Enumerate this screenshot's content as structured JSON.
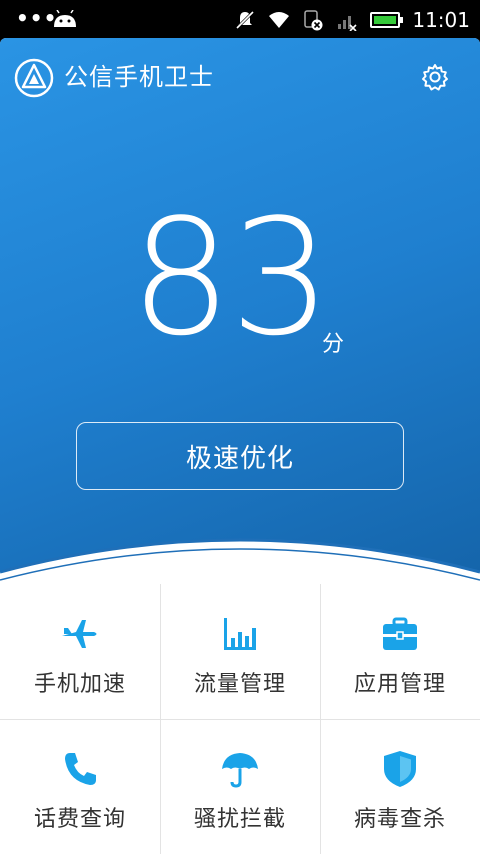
{
  "statusbar": {
    "time": "11:01",
    "icons": [
      "more-dots-icon",
      "android-icon",
      "silent-icon",
      "wifi-icon",
      "sim-error-icon",
      "signal-icon",
      "battery-icon"
    ],
    "battery_color": "#36c93a"
  },
  "header": {
    "title": "公信手机卫士",
    "logo": "shield-logo-icon",
    "settings_icon": "gear-icon"
  },
  "score": {
    "value": "83",
    "unit": "分"
  },
  "action": {
    "optimize_label": "极速优化"
  },
  "colors": {
    "hero_top": "#2a94e4",
    "hero_bottom": "#1463a8",
    "icon_accent": "#1aa3e8"
  },
  "tools": [
    {
      "label": "手机加速",
      "icon": "airplane-icon"
    },
    {
      "label": "流量管理",
      "icon": "bar-chart-icon"
    },
    {
      "label": "应用管理",
      "icon": "toolbox-icon"
    },
    {
      "label": "话费查询",
      "icon": "phone-icon"
    },
    {
      "label": "骚扰拦截",
      "icon": "umbrella-icon"
    },
    {
      "label": "病毒查杀",
      "icon": "shield-icon"
    }
  ]
}
